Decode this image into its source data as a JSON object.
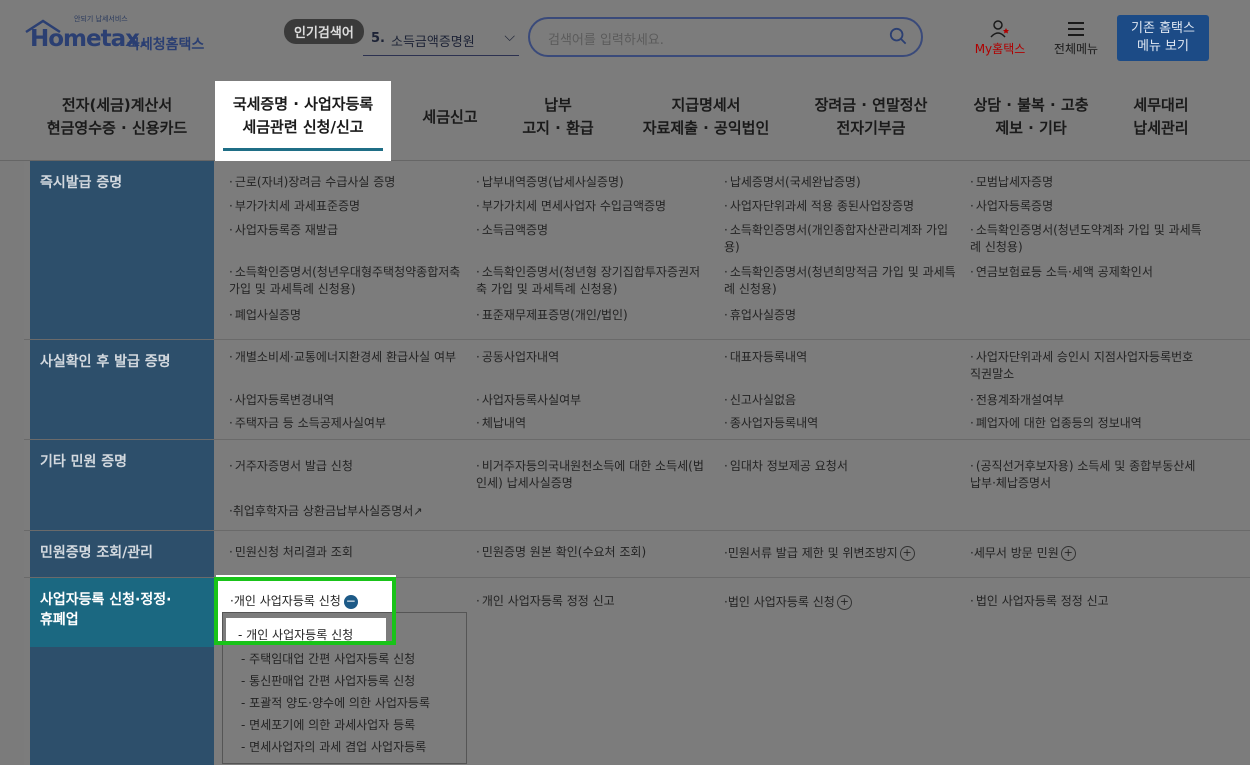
{
  "header": {
    "logo_small": "안되기 납세서비스",
    "logo_main": "Hometax.",
    "logo_sub": "국세청홈택스",
    "popular_badge": "인기검색어",
    "popular_num": "5.",
    "popular_term": "소득금액증명원",
    "search_placeholder": "검색어를 입력하세요.",
    "my_label": "My홈택스",
    "all_menu_label": "전체메뉴",
    "old_home_line1": "기존 홈택스",
    "old_home_line2": "메뉴 보기"
  },
  "nav": [
    {
      "line1": "전자(세금)계산서",
      "line2": "현금영수증 · 신용카드"
    },
    {
      "line1": "국세증명 · 사업자등록",
      "line2": "세금관련 신청/신고"
    },
    {
      "line1": "세금신고",
      "line2": ""
    },
    {
      "line1": "납부",
      "line2": "고지 · 환급"
    },
    {
      "line1": "지급명세서",
      "line2": "자료제출 · 공익법인"
    },
    {
      "line1": "장려금 · 연말정산",
      "line2": "전자기부금"
    },
    {
      "line1": "상담 · 불복 · 고충",
      "line2": "제보 · 기타"
    },
    {
      "line1": "세무대리",
      "line2": "납세관리"
    }
  ],
  "sections": {
    "s1": {
      "title": "즉시발급 증명",
      "items": [
        "근로(자녀)장려금 수급사실 증명",
        "납부내역증명(납세사실증명)",
        "납세증명서(국세완납증명)",
        "모범납세자증명",
        "부가가치세 과세표준증명",
        "부가가치세 면세사업자 수입금액증명",
        "사업자단위과세 적용 종된사업장증명",
        "사업자등록증명",
        "사업자등록증 재발급",
        "소득금액증명",
        "소득확인증명서(개인종합자산관리계좌 가입용)",
        "소득확인증명서(청년도약계좌 가입 및 과세특례 신청용)",
        "소득확인증명서(청년우대형주택청약종합저축 가입 및 과세특례 신청용)",
        "소득확인증명서(청년형 장기집합투자증권저축 가입 및 과세특례 신청용)",
        "소득확인증명서(청년희망적금 가입 및 과세특례 신청용)",
        "연금보험료등 소득·세액 공제확인서",
        "폐업사실증명",
        "표준재무제표증명(개인/법인)",
        "휴업사실증명"
      ]
    },
    "s2": {
      "title": "사실확인 후 발급 증명",
      "items": [
        "개별소비세·교통에너지환경세 환급사실 여부",
        "공동사업자내역",
        "대표자등록내역",
        "사업자단위과세 승인시 지점사업자등록번호 직권말소",
        "사업자등록변경내역",
        "사업자등록사실여부",
        "신고사실없음",
        "전용계좌개설여부",
        "주택자금 등 소득공제사실여부",
        "체납내역",
        "종사업자등록내역",
        "폐업자에 대한 업종등의 정보내역"
      ]
    },
    "s3": {
      "title": "기타 민원 증명",
      "items": [
        "거주자증명서 발급 신청",
        "비거주자등의국내원천소득에 대한 소득세(법인세) 납세사실증명",
        "임대차 정보제공 요청서",
        "(공직선거후보자용) 소득세 및 종합부동산세 납부·체납증명서",
        "취업후학자금 상환금납부사실증명서"
      ],
      "ext_icon": "↗"
    },
    "s4": {
      "title": "민원증명 조회/관리",
      "items": [
        "민원신청 처리결과 조회",
        "민원증명 원본 확인(수요처 조회)",
        "민원서류 발급 제한 및 위변조방지",
        "세무서 방문 민원"
      ],
      "plus": "+"
    },
    "s5": {
      "title_line1": "사업자등록 신청·정정·",
      "title_line2": "휴폐업",
      "items": [
        "개인 사업자등록 신청",
        "개인 사업자등록 정정 신고",
        "법인 사업자등록 신청",
        "법인 사업자등록 정정 신고"
      ],
      "minus": "−",
      "plus": "+",
      "submenu": [
        "개인 사업자등록 신청",
        "주택임대업 간편 사업자등록 신청",
        "통신판매업 간편 사업자등록 신청",
        "포괄적 양도·양수에 의한 사업자등록",
        "면세포기에 의한 과세사업자 등록",
        "면세사업자의 과세 겸업 사업자등록"
      ]
    }
  },
  "colors": {
    "section_head": "#2d4f6b",
    "section_head_active": "#1b6881",
    "highlight_border": "#19c319",
    "old_home_bg": "#1c4b86"
  }
}
